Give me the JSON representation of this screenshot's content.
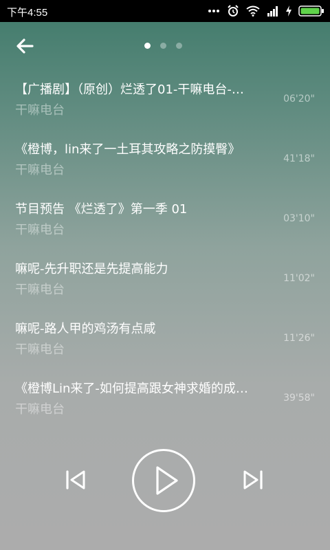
{
  "status_bar": {
    "time": "下午4:55",
    "icons": [
      "more-dots-icon",
      "alarm-icon",
      "wifi-icon",
      "signal-icon",
      "charging-icon",
      "battery-icon"
    ]
  },
  "header": {
    "back_icon": "back-arrow-icon",
    "page_count": 3,
    "active_page": 1
  },
  "tracks": [
    {
      "title": "【广播剧】（原创）烂透了01-干嘛电台-…",
      "artist": "干嘛电台",
      "duration": "06'20\""
    },
    {
      "title": "《橙博，lin来了一土耳其攻略之防摸臀》",
      "artist": "干嘛电台",
      "duration": "41'18\""
    },
    {
      "title": "节目预告 《烂透了》第一季 01",
      "artist": "干嘛电台",
      "duration": "03'10\""
    },
    {
      "title": "嘛呢-先升职还是先提高能力",
      "artist": "干嘛电台",
      "duration": "11'02\""
    },
    {
      "title": "嘛呢-路人甲的鸡汤有点咸",
      "artist": "干嘛电台",
      "duration": "11'26\""
    },
    {
      "title": "《橙博Lin来了-如何提高跟女神求婚的成…",
      "artist": "干嘛电台",
      "duration": "39'58\""
    }
  ],
  "controls": {
    "prev_icon": "skip-previous-icon",
    "play_icon": "play-icon",
    "next_icon": "skip-next-icon"
  },
  "colors": {
    "gradient_top": "#3f7a6a",
    "gradient_bottom": "#acacac",
    "battery": "#5fd34a"
  }
}
